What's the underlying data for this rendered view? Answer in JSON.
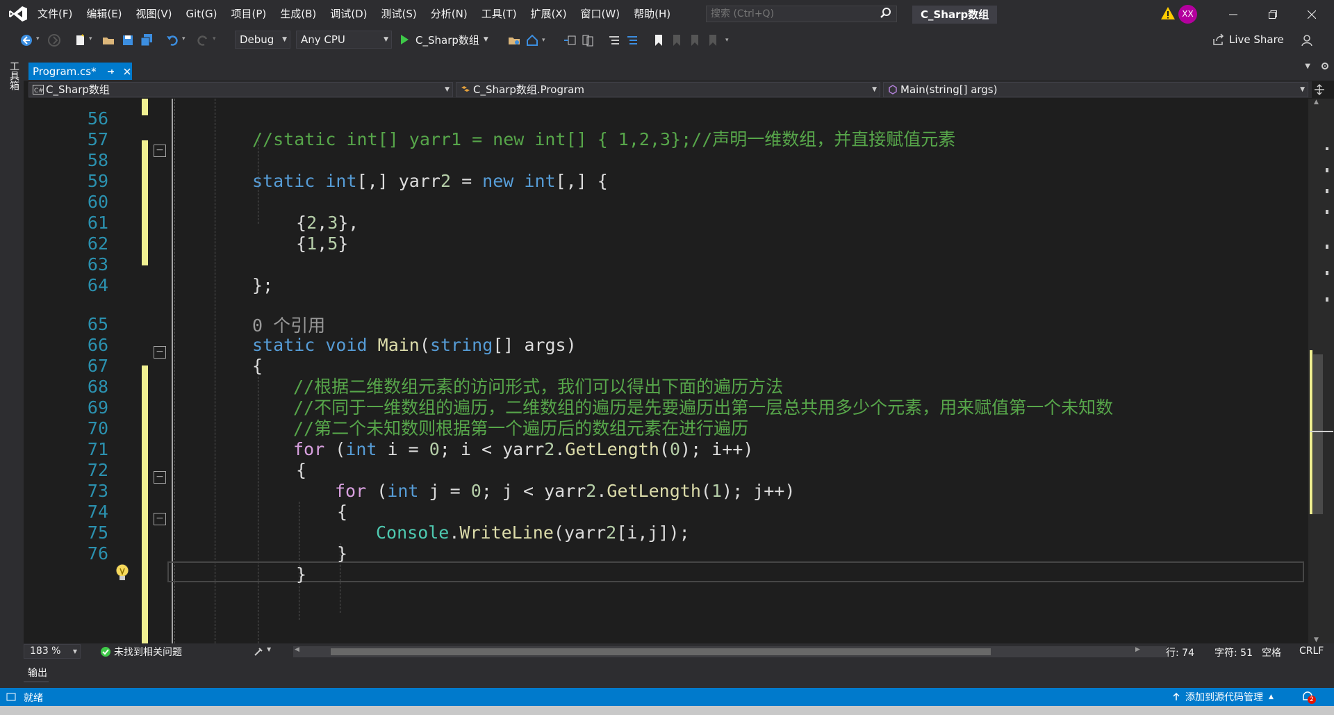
{
  "menu": [
    "文件(F)",
    "编辑(E)",
    "视图(V)",
    "Git(G)",
    "项目(P)",
    "生成(B)",
    "调试(D)",
    "测试(S)",
    "分析(N)",
    "工具(T)",
    "扩展(X)",
    "窗口(W)",
    "帮助(H)"
  ],
  "search": {
    "placeholder": "搜索 (Ctrl+Q)"
  },
  "solution_title": "C_Sharp数组",
  "avatar_initials": "XX",
  "toolbar": {
    "config": "Debug",
    "platform": "Any CPU",
    "run_label": "C_Sharp数组",
    "live_share": "Live Share"
  },
  "toolbox_label": "工具箱",
  "tab": {
    "label": "Program.cs*"
  },
  "navbar": {
    "project": "C_Sharp数组",
    "class": "C_Sharp数组.Program",
    "member": "Main(string[] args)"
  },
  "code_lines": [
    {
      "num": "56",
      "text": "//static int[] yarr1 = new int[] { 1,2,3};//声明一维数组，并直接赋值元素"
    },
    {
      "num": "57",
      "text": ""
    },
    {
      "num": "58",
      "text": "static int[,] yarr2 = new int[,] {"
    },
    {
      "num": "59",
      "text": ""
    },
    {
      "num": "60",
      "text": "{2,3},"
    },
    {
      "num": "61",
      "text": "{1,5}"
    },
    {
      "num": "62",
      "text": ""
    },
    {
      "num": "63",
      "text": "};"
    },
    {
      "num": "64",
      "text": ""
    },
    {
      "num": "",
      "text": "0 个引用"
    },
    {
      "num": "65",
      "text": "static void Main(string[] args)"
    },
    {
      "num": "66",
      "text": "{"
    },
    {
      "num": "67",
      "text": "//根据二维数组元素的访问形式，我们可以得出下面的遍历方法"
    },
    {
      "num": "68",
      "text": "//不同于一维数组的遍历，二维数组的遍历是先要遍历出第一层总共用多少个元素，用来赋值第一个未知数"
    },
    {
      "num": "69",
      "text": "//第二个未知数则根据第一个遍历后的数组元素在进行遍历"
    },
    {
      "num": "70",
      "text": "for (int i = 0; i < yarr2.GetLength(0); i++)"
    },
    {
      "num": "71",
      "text": "{"
    },
    {
      "num": "72",
      "text": "for (int j = 0; j < yarr2.GetLength(1); j++)"
    },
    {
      "num": "73",
      "text": "{"
    },
    {
      "num": "74",
      "text": "Console.WriteLine(yarr2[i,j]);"
    },
    {
      "num": "75",
      "text": "}"
    },
    {
      "num": "76",
      "text": "}"
    }
  ],
  "editor_status": {
    "zoom": "183 %",
    "issues": "未找到相关问题",
    "line": "行: 74",
    "col": "字符: 51",
    "spacing": "空格",
    "eol": "CRLF"
  },
  "output_label": "输出",
  "status": {
    "ready": "就绪",
    "source_control": "添加到源代码管理",
    "notifications": "2"
  },
  "colors": {
    "accent": "#007acc",
    "keyword": "#569cd6",
    "comment": "#57a64a",
    "type": "#4ec9b0",
    "method": "#dcdcaa",
    "control": "#d8a0df",
    "line_number": "#2b91af"
  }
}
